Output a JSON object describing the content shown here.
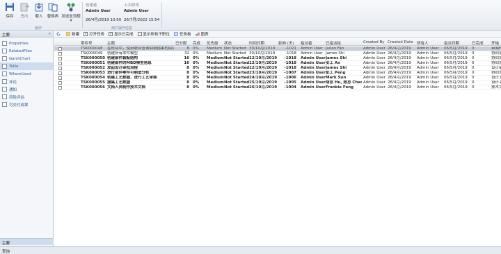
{
  "ribbon": {
    "buttons": [
      {
        "label": "保存",
        "icon": "save-icon",
        "disabled": false
      },
      {
        "label": "签出",
        "icon": "checkout-icon",
        "disabled": true
      },
      {
        "label": "载入",
        "icon": "load-icon",
        "disabled": false
      },
      {
        "label": "替换再",
        "icon": "replace-icon",
        "disabled": false
      },
      {
        "label": "发送至流程",
        "icon": "send-workflow-icon",
        "disabled": false
      }
    ],
    "group_label": "操作",
    "info": {
      "creator_label": "创建者",
      "creator": "Admin User",
      "created": "26/4月/2019 10:50",
      "modifier_label": "上次修改",
      "modifier": "Admin User",
      "modified": "26/7月/2022 15:54",
      "group_label": "用户操作信息"
    }
  },
  "sidebar": {
    "header": "主要",
    "items": [
      {
        "label": "Properties",
        "icon": "properties-icon"
      },
      {
        "label": "RelatedFiles",
        "icon": "related-files-icon"
      },
      {
        "label": "GanttChart",
        "icon": "gantt-chart-icon"
      },
      {
        "label": "ToDo",
        "icon": "todo-icon"
      },
      {
        "label": "WhereUsed",
        "icon": "where-used-icon"
      },
      {
        "label": "评论",
        "icon": "comment-icon"
      },
      {
        "label": "通知",
        "icon": "notification-icon"
      },
      {
        "label": "风险评估",
        "icon": "risk-icon"
      },
      {
        "label": "可交付成果",
        "icon": "deliverable-icon"
      }
    ],
    "selected_index": 3,
    "bottom_main": "主要",
    "bottom_query": "查询"
  },
  "toolbar": {
    "items": [
      {
        "label": "",
        "icon": "refresh-icon"
      },
      {
        "label": "新建",
        "icon": "new-icon"
      },
      {
        "label": "打开任务",
        "icon": "open-task-icon",
        "checkbox": true,
        "checked": true
      },
      {
        "label": "显示已完成",
        "checkbox": true,
        "checked": true
      },
      {
        "label": "显示所有子职位",
        "checkbox": true,
        "checked": false
      },
      {
        "label": "任务板",
        "icon": "task-board-icon"
      },
      {
        "label": "图表",
        "icon": "chart-icon"
      }
    ]
  },
  "grid": {
    "columns": [
      "零件号",
      "主题",
      "已分配",
      "完成",
      "优先级",
      "状态",
      "时间日期",
      "影响 (天)",
      "指派者",
      "已指派给",
      "Created By",
      "Created Date",
      "所有人",
      "指派日期",
      "已完成",
      "开始"
    ],
    "rows": [
      {
        "id": "TSK000048",
        "subject": "在时间中，使用联合查询回填结果的回填模型",
        "assigned": "8",
        "done": "0%",
        "priority": "Medium",
        "status": "Not Started",
        "date": "30/10月/2019",
        "impact": "-1021",
        "assignor": "Admin User",
        "assignee": "Julian Fan",
        "created_by": "Admin User",
        "created_date": "26/4月/2019",
        "owner": "Admin User",
        "assign_date": "06/5月/2019",
        "completed": "0",
        "start": "审阅时间"
      },
      {
        "id": "TSK000049",
        "subject": "创建所有零件模型",
        "assigned": "32",
        "done": "0%",
        "priority": "Medium",
        "status": "Not Started",
        "date": "30/10月/2019",
        "impact": "-1018",
        "assignor": "Admin User",
        "assignee": "James Shi",
        "created_by": "Admin User",
        "created_date": "26/4月/2019",
        "owner": "Admin User",
        "assign_date": "06/5月/2019",
        "completed": "0",
        "start": "协同设计"
      },
      {
        "id": "TSK000050",
        "subject": "创建部件装配结构",
        "assigned": "16",
        "done": "0%",
        "priority": "Medium",
        "status": "Not Started",
        "date": "12/10月/2019",
        "impact": "-1018",
        "assignor": "Admin User",
        "assignee": "James Shi",
        "created_by": "Admin User",
        "created_date": "26/4月/2019",
        "owner": "Admin User",
        "assign_date": "06/5月/2019",
        "completed": "0",
        "start": "协同设计"
      },
      {
        "id": "TSK000051",
        "subject": "创建部件的MBD模型信息",
        "assigned": "16",
        "done": "0%",
        "priority": "Medium",
        "status": "Not Started",
        "date": "12/10月/2019",
        "impact": "-1018",
        "assignor": "Admin User",
        "assignee": "安工 An",
        "created_by": "Admin User",
        "created_date": "26/4月/2019",
        "owner": "Admin User",
        "assign_date": "06/5月/2019",
        "completed": "0",
        "start": "协同设计"
      },
      {
        "id": "TSK000052",
        "subject": "发起设计审批流程",
        "assigned": "8",
        "done": "0%",
        "priority": "Medium",
        "status": "Not Started",
        "date": "12/10月/2019",
        "impact": "-1018",
        "assignor": "Admin User",
        "assignee": "James Shi",
        "created_by": "Admin User",
        "created_date": "26/4月/2019",
        "owner": "Admin User",
        "assign_date": "06/5月/2019",
        "completed": "0",
        "start": "设计审批"
      },
      {
        "id": "TSK000053",
        "subject": "进行部件零件可制造分析",
        "assigned": "8",
        "done": "0%",
        "priority": "Medium",
        "status": "Not Started",
        "date": "23/10月/2019",
        "impact": "-1007",
        "assignor": "Admin User",
        "assignee": "彭工 Peng",
        "created_by": "Admin User",
        "created_date": "26/4月/2019",
        "owner": "Admin User",
        "assign_date": "06/5月/2019",
        "completed": "0",
        "start": "协同设计"
      },
      {
        "id": "TSK000054",
        "subject": "创建工艺数据，进行工艺审核",
        "assigned": "8",
        "done": "0%",
        "priority": "Medium",
        "status": "Not Started",
        "date": "24/10月/2019",
        "impact": "-1006",
        "assignor": "Admin User",
        "assignee": "Mark Sun",
        "created_by": "Admin User",
        "created_date": "26/4月/2019",
        "owner": "Admin User",
        "assign_date": "06/5月/2019",
        "completed": "0",
        "start": "设计工艺"
      },
      {
        "id": "TSK000055",
        "subject": "搜集工艺数据",
        "assigned": "8",
        "done": "0%",
        "priority": "Medium",
        "status": "Not Started",
        "date": "25/10月/2019",
        "impact": "-1005",
        "assignor": "Admin User",
        "assignee": "胡总 Hu, 陈总 Chen",
        "created_by": "Admin User",
        "created_date": "26/4月/2019",
        "owner": "Admin User",
        "assign_date": "06/5月/2019",
        "completed": "0",
        "start": "设计工艺"
      },
      {
        "id": "TSK000056",
        "subject": "文档人员制作技术文档",
        "assigned": "8",
        "done": "0%",
        "priority": "Medium",
        "status": "Not Started",
        "date": "26/10月/2019",
        "impact": "-1004",
        "assignor": "Admin User",
        "assignee": "Frankie Feng",
        "created_by": "Admin User",
        "created_date": "26/4月/2019",
        "owner": "Admin User",
        "assign_date": "06/5月/2019",
        "completed": "0",
        "start": "技术文档"
      }
    ],
    "selected_index": 0
  },
  "colors": {
    "accent": "#2a5a9a",
    "selection": "#c9ced6",
    "ribbon": "#e6ebf2"
  }
}
